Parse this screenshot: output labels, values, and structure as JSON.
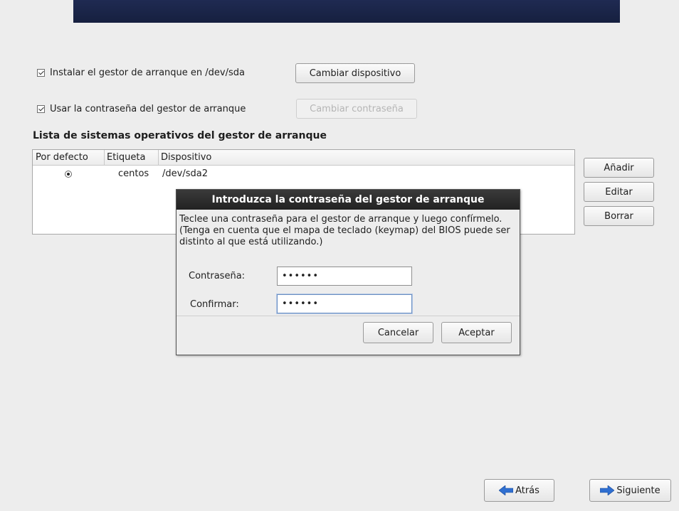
{
  "install_bootloader": {
    "checked": true,
    "label": "Instalar el gestor de arranque en /dev/sda",
    "button": "Cambiar dispositivo"
  },
  "use_password": {
    "checked": true,
    "label": "Usar la contraseña del gestor de arranque",
    "button": "Cambiar contraseña"
  },
  "os_list": {
    "title": "Lista de sistemas operativos del gestor de arranque",
    "columns": [
      "Por defecto",
      "Etiqueta",
      "Dispositivo"
    ],
    "rows": [
      {
        "default": true,
        "label": "centos",
        "device": "/dev/sda2"
      }
    ]
  },
  "side_buttons": {
    "add": "Añadir",
    "edit": "Editar",
    "delete": "Borrar"
  },
  "dialog": {
    "title": "Introduzca la contraseña del gestor de arranque",
    "message": "Teclee una contraseña para el gestor de arranque y luego confírmelo. (Tenga en cuenta que el mapa de teclado (keymap) del BIOS puede ser distinto al que está utilizando.)",
    "password_label": "Contraseña:",
    "password_value": "••••••",
    "confirm_label": "Confirmar:",
    "confirm_value": "••••••",
    "cancel": "Cancelar",
    "accept": "Aceptar"
  },
  "nav": {
    "back": "Atrás",
    "next": "Siguiente"
  },
  "colors": {
    "banner": "#1f2a52",
    "dialog_title_bg": "#2b2b2b",
    "nav_arrow": "#2f6fd1"
  }
}
